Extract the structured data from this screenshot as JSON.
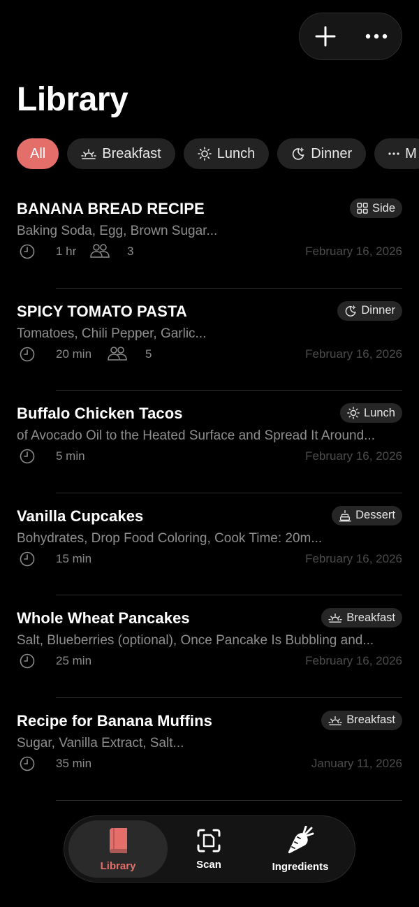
{
  "header": {
    "title": "Library",
    "actions": [
      {
        "icon": "plus-icon"
      },
      {
        "icon": "more-icon"
      }
    ]
  },
  "filters": [
    {
      "label": "All",
      "icon": null,
      "active": true
    },
    {
      "label": "Breakfast",
      "icon": "sunrise-icon",
      "active": false
    },
    {
      "label": "Lunch",
      "icon": "sun-icon",
      "active": false
    },
    {
      "label": "Dinner",
      "icon": "moon-icon",
      "active": false
    },
    {
      "label": "M",
      "icon": "more-icon",
      "active": false
    }
  ],
  "recipes": [
    {
      "title": "BANANA BREAD RECIPE",
      "category": "Side",
      "category_icon": "grid-icon",
      "ingredients": "Baking Soda, Egg, Brown Sugar...",
      "time": "1 hr",
      "servings": "3",
      "date": "February 16, 2026"
    },
    {
      "title": "SPICY TOMATO PASTA",
      "category": "Dinner",
      "category_icon": "moon-icon",
      "ingredients": "Tomatoes, Chili Pepper, Garlic...",
      "time": "20 min",
      "servings": "5",
      "date": "February 16, 2026"
    },
    {
      "title": "Buffalo Chicken Tacos",
      "category": "Lunch",
      "category_icon": "sun-icon",
      "ingredients": "of Avocado Oil to the Heated Surface and Spread It Around...",
      "time": "5 min",
      "servings": null,
      "date": "February 16, 2026"
    },
    {
      "title": "Vanilla Cupcakes",
      "category": "Dessert",
      "category_icon": "cake-icon",
      "ingredients": "Bohydrates, Drop Food Coloring, Cook Time: 20m...",
      "time": "15 min",
      "servings": null,
      "date": "February 16, 2026"
    },
    {
      "title": "Whole Wheat Pancakes",
      "category": "Breakfast",
      "category_icon": "sunrise-icon",
      "ingredients": "Salt, Blueberries (optional), Once Pancake Is Bubbling and...",
      "time": "25 min",
      "servings": null,
      "date": "February 16, 2026"
    },
    {
      "title": "Recipe for Banana Muffins",
      "category": "Breakfast",
      "category_icon": "sunrise-icon",
      "ingredients": "Sugar, Vanilla Extract, Salt...",
      "time": "35 min",
      "servings": null,
      "date": "January 11, 2026"
    }
  ],
  "tabbar": {
    "tabs": [
      {
        "label": "Library",
        "icon": "book-icon",
        "active": true
      },
      {
        "label": "Scan",
        "icon": "scan-icon",
        "active": false
      },
      {
        "label": "Ingredients",
        "icon": "carrot-icon",
        "active": false
      }
    ]
  },
  "colors": {
    "accent": "#e46e6a",
    "background": "#000000",
    "chip": "#232323",
    "muted_text": "#8e8e8e",
    "date_text": "#4c4c4c"
  }
}
